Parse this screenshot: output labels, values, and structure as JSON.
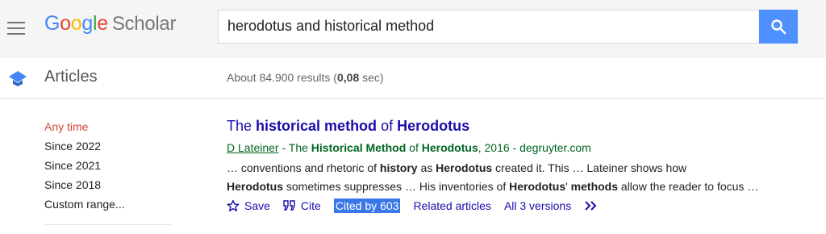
{
  "header": {
    "logo_google": [
      "G",
      "o",
      "o",
      "g",
      "l",
      "e"
    ],
    "logo_scholar": "Scholar",
    "search_value": "herodotus and historical method"
  },
  "subbar": {
    "section_label": "Articles",
    "results_prefix": "About 84.900 results (",
    "results_time": "0,08",
    "results_suffix": " sec)"
  },
  "filters": [
    "Any time",
    "Since 2022",
    "Since 2021",
    "Since 2018",
    "Custom range..."
  ],
  "result": {
    "title_parts": [
      {
        "text": "The ",
        "bold": false
      },
      {
        "text": "historical method",
        "bold": true
      },
      {
        "text": " of ",
        "bold": false
      },
      {
        "text": "Herodotus",
        "bold": true
      }
    ],
    "author": "D Lateiner",
    "meta_parts": [
      {
        "text": " - The ",
        "bold": false
      },
      {
        "text": "Historical Method",
        "bold": true
      },
      {
        "text": " of ",
        "bold": false
      },
      {
        "text": "Herodotus",
        "bold": true
      },
      {
        "text": ", 2016 - degruyter.com",
        "bold": false
      }
    ],
    "snippet_line1": [
      {
        "text": "… conventions and rhetoric of ",
        "bold": false
      },
      {
        "text": "history",
        "bold": true
      },
      {
        "text": " as ",
        "bold": false
      },
      {
        "text": "Herodotus",
        "bold": true
      },
      {
        "text": " created it. This … Lateiner shows how",
        "bold": false
      }
    ],
    "snippet_line2": [
      {
        "text": "Herodotus",
        "bold": true
      },
      {
        "text": " sometimes suppresses … His inventories of ",
        "bold": false
      },
      {
        "text": "Herodotus",
        "bold": true
      },
      {
        "text": "' ",
        "bold": false
      },
      {
        "text": "methods",
        "bold": true
      },
      {
        "text": " allow the reader to focus …",
        "bold": false
      }
    ],
    "actions": {
      "save": "Save",
      "cite": "Cite",
      "cited_by": "Cited by 603",
      "related": "Related articles",
      "versions": "All 3 versions"
    }
  },
  "icons": {
    "menu": "menu-icon",
    "search": "search-icon",
    "articles": "graduation-cap-icon",
    "save": "star-icon",
    "cite": "quote-icon",
    "more": "double-chevron-icon"
  },
  "colors": {
    "link": "#1a0dab",
    "green": "#006621",
    "active_filter": "#d14836",
    "search_button": "#4d90fe",
    "highlight": "#3b78e7"
  }
}
